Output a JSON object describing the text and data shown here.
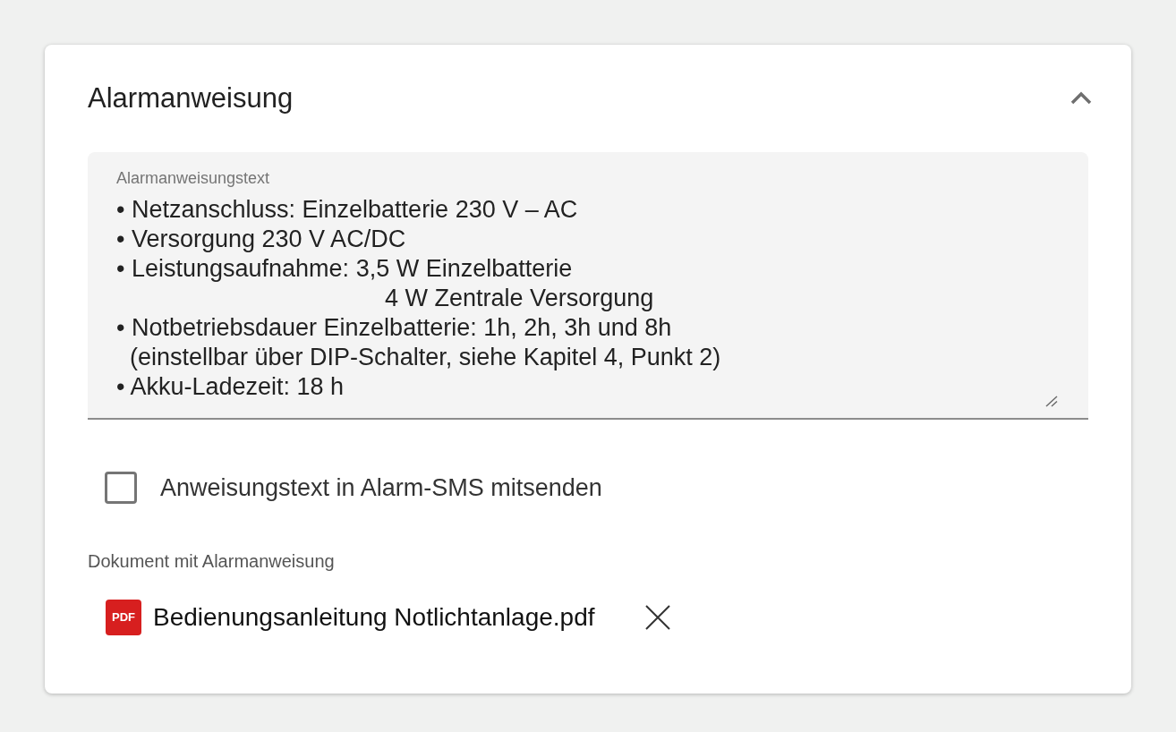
{
  "card": {
    "title": "Alarmanweisung",
    "expanded": true
  },
  "instruction_field": {
    "label": "Alarmanweisungstext",
    "value": "• Netzanschluss: Einzelbatterie 230 V – AC\n• Versorgung 230 V AC/DC\n• Leistungsaufnahme: 3,5 W Einzelbatterie\n                                        4 W Zentrale Versorgung\n• Notbetriebsdauer Einzelbatterie: 1h, 2h, 3h und 8h\n  (einstellbar über DIP-Schalter, siehe Kapitel 4, Punkt 2)\n• Akku-Ladezeit: 18 h"
  },
  "sms_checkbox": {
    "label": "Anweisungstext in Alarm-SMS mitsenden",
    "checked": false
  },
  "document": {
    "label": "Dokument mit Alarmanweisung",
    "file": {
      "badge": "PDF",
      "name": "Bedienungsanleitung Notlichtanlage.pdf"
    }
  }
}
